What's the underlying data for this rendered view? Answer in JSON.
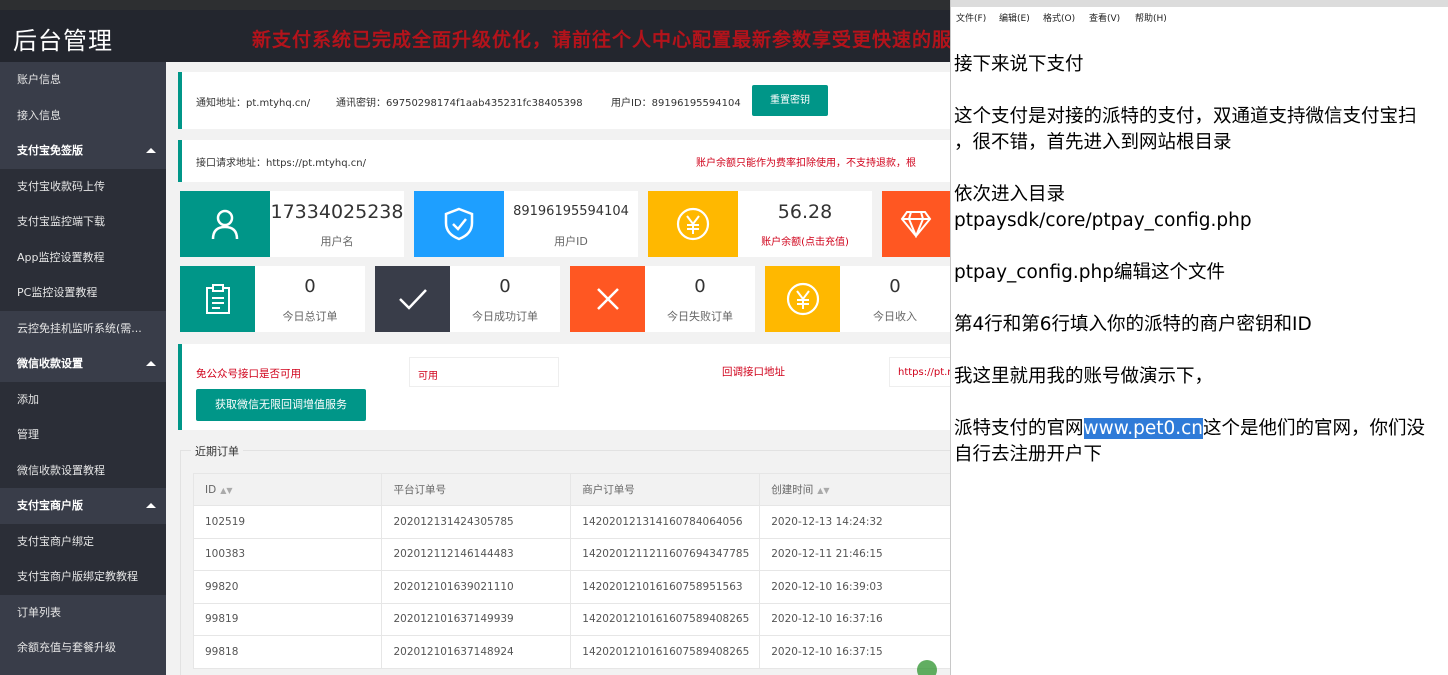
{
  "admin": {
    "brand": "后台管理",
    "marquee": "新支付系统已完成全面升级优化，请前往个人中心配置最新参数享受更快速的服务体验一站式",
    "sidebar": {
      "items": [
        {
          "label": "账户信息",
          "kind": "top"
        },
        {
          "label": "接入信息",
          "kind": "top"
        },
        {
          "label": "支付宝免签版",
          "kind": "group"
        },
        {
          "label": "支付宝收款码上传",
          "kind": "sub"
        },
        {
          "label": "支付宝监控端下载",
          "kind": "sub"
        },
        {
          "label": "App监控设置教程",
          "kind": "sub"
        },
        {
          "label": "PC监控设置教程",
          "kind": "sub"
        },
        {
          "label": "云控免挂机监听系统(需...",
          "kind": "top"
        },
        {
          "label": "微信收款设置",
          "kind": "group"
        },
        {
          "label": "添加",
          "kind": "sub"
        },
        {
          "label": "管理",
          "kind": "sub"
        },
        {
          "label": "微信收款设置教程",
          "kind": "sub"
        },
        {
          "label": "支付宝商户版",
          "kind": "group"
        },
        {
          "label": "支付宝商户绑定",
          "kind": "sub"
        },
        {
          "label": "支付宝商户版绑定教教程",
          "kind": "sub"
        },
        {
          "label": "订单列表",
          "kind": "top"
        },
        {
          "label": "余额充值与套餐升级",
          "kind": "top"
        }
      ]
    },
    "notify": {
      "notify_label": "通知地址：pt.mtyhq.cn/",
      "key_label": "通讯密钥：69750298174f1aab435231fc38405398",
      "uid_label": "用户ID：89196195594104",
      "reset_button": "重置密钥"
    },
    "api": {
      "api_label": "接口请求地址：https://pt.mtyhq.cn/",
      "warning": "账户余额只能作为费率扣除使用，不支持退款，根"
    },
    "stats_top": [
      {
        "value": "17334025238",
        "label": "用户名",
        "icon": "user-icon",
        "color": "#009688"
      },
      {
        "value": "89196195594104",
        "label": "用户ID",
        "icon": "shield-check-icon",
        "color": "#1e9fff"
      },
      {
        "value": "56.28",
        "label": "账户余额(点击充值)",
        "icon": "yen-icon",
        "color": "#ffb800"
      },
      {
        "value": "",
        "label": "",
        "icon": "diamond-icon",
        "color": "#ff5722"
      }
    ],
    "stats_today": [
      {
        "value": "0",
        "label": "今日总订单",
        "icon": "clipboard-icon",
        "color": "#009688"
      },
      {
        "value": "0",
        "label": "今日成功订单",
        "icon": "check-icon",
        "color": "#393d49"
      },
      {
        "value": "0",
        "label": "今日失败订单",
        "icon": "cross-icon",
        "color": "#ff5722"
      },
      {
        "value": "0",
        "label": "今日收入",
        "icon": "yen-icon",
        "color": "#ffb800"
      }
    ],
    "wechat": {
      "public_label": "免公众号接口是否可用",
      "public_value": "可用",
      "callback_label": "回调接口地址",
      "callback_value": "https://pt.m",
      "get_button": "获取微信无限回调增值服务"
    },
    "orders": {
      "legend": "近期订单",
      "headers": [
        "ID",
        "平台订单号",
        "商户订单号",
        "创建时间"
      ],
      "rows": [
        [
          "102519",
          "202012131424305785",
          "14202012131416078406405​6",
          "2020-12-13 14:24:32"
        ],
        [
          "100383",
          "202012112146144483",
          "14202012112116076943477​85",
          "2020-12-11 21:46:15"
        ],
        [
          "99820",
          "202012101639021110",
          "14202012101616075895156​3",
          "2020-12-10 16:39:03"
        ],
        [
          "99819",
          "202012101637149939",
          "14202012101616075894082​65",
          "2020-12-10 16:37:16"
        ],
        [
          "99818",
          "202012101637148924",
          "14202012101616075894082​65",
          "2020-12-10 16:37:15"
        ]
      ]
    }
  },
  "notepad": {
    "menu": [
      "文件(F)",
      "编辑(E)",
      "格式(O)",
      "查看(V)",
      "帮助(H)"
    ],
    "lines": {
      "l1": "接下来说下支付",
      "l2": "这个支付是对接的派特的支付，双通道支持微信支付宝扫",
      "l3": "，很不错，首先进入到网站根目录",
      "l4": "依次进入目录",
      "l5": "ptpaysdk/core/ptpay_config.php",
      "l6": "ptpay_config.php编辑这个文件",
      "l7": "第4行和第6行填入你的派特的商户密钥和ID",
      "l8": "我这里就用我的账号做演示下，",
      "l9_pre": "派特支付的官网",
      "l9_link": "www.pet0.cn",
      "l9_post": "这个是他们的官网，你们没",
      "l10": "自行去注册开户下"
    }
  }
}
